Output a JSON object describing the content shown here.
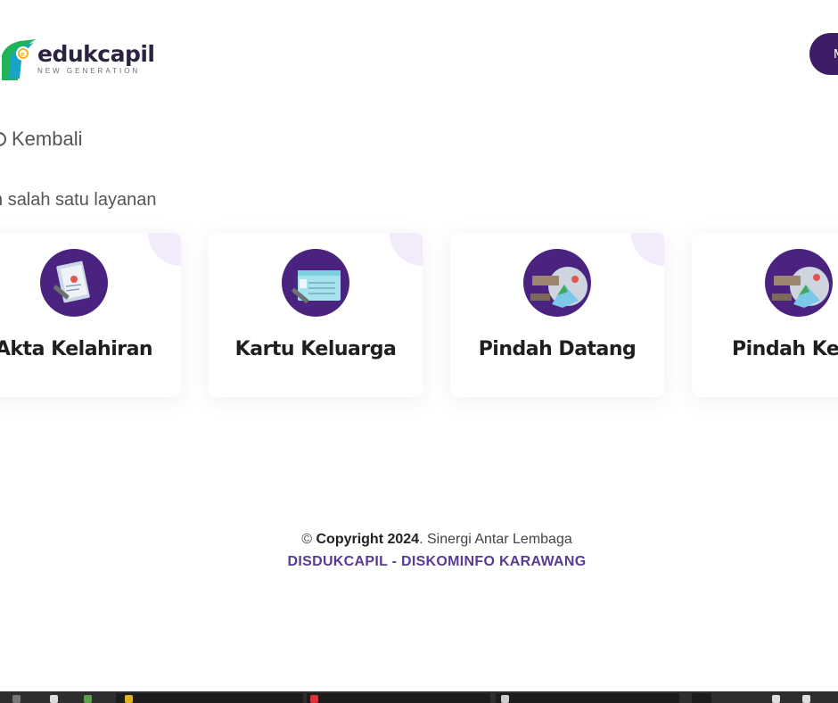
{
  "header": {
    "logo_word": "edukcapil",
    "logo_sub": "NEW GENERATION",
    "right_button_label": "M"
  },
  "nav": {
    "back_label": "Kembali"
  },
  "instruction": "salah satu layanan",
  "services": [
    {
      "label": "Akta Kelahiran",
      "icon": "birth-certificate-icon"
    },
    {
      "label": "Kartu Keluarga",
      "icon": "family-card-icon"
    },
    {
      "label": "Pindah Datang",
      "icon": "relocation-in-icon"
    },
    {
      "label": "Pindah Kelu",
      "icon": "relocation-out-icon"
    }
  ],
  "footer": {
    "copyright_symbol": "©",
    "copyright_label": "Copyright 2024",
    "tagline": ". Sinergi Antar Lembaga",
    "org": "DISDUKCAPIL - DISKOMINFO KARAWANG"
  },
  "colors": {
    "primary": "#3c1d66",
    "accent": "#5b3a94",
    "corner": "#f1ebfb",
    "logo_green": "#1fb35a",
    "logo_teal": "#1aa3c9"
  }
}
